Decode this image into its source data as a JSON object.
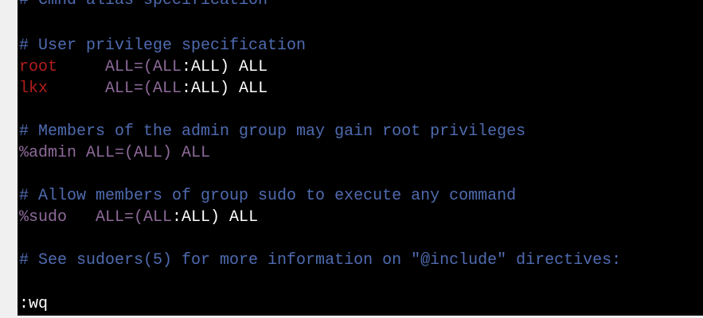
{
  "editor": {
    "lines": [
      {
        "id": "cmnd-alias-comment",
        "text": "# Cmnd alias specification"
      },
      {
        "id": "user-priv-comment",
        "text": "# User privilege specification"
      },
      {
        "id": "root-rule",
        "user": "root",
        "spec_open": "ALL=(ALL",
        "spec_colon": ":ALL) ALL"
      },
      {
        "id": "lkx-rule",
        "user": "lkx",
        "spec_open": "ALL=(ALL",
        "spec_colon": ":ALL) ALL"
      },
      {
        "id": "admin-comment",
        "text": "# Members of the admin group may gain root privileges"
      },
      {
        "id": "admin-rule",
        "text": "%admin ALL=(ALL) ALL"
      },
      {
        "id": "sudo-comment",
        "text": "# Allow members of group sudo to execute any command"
      },
      {
        "id": "sudo-rule",
        "group": "%sudo",
        "spec_open": "ALL=(ALL",
        "spec_colon": ":ALL) ALL"
      },
      {
        "id": "include-comment",
        "text": "# See sudoers(5) for more information on \"@include\" directives:"
      }
    ],
    "command_line": ":wq"
  },
  "colors": {
    "background": "#000000",
    "comment": "#4f6bb0",
    "user": "#b31d1d",
    "spec": "#8e6a9a",
    "text": "#ffffff"
  }
}
